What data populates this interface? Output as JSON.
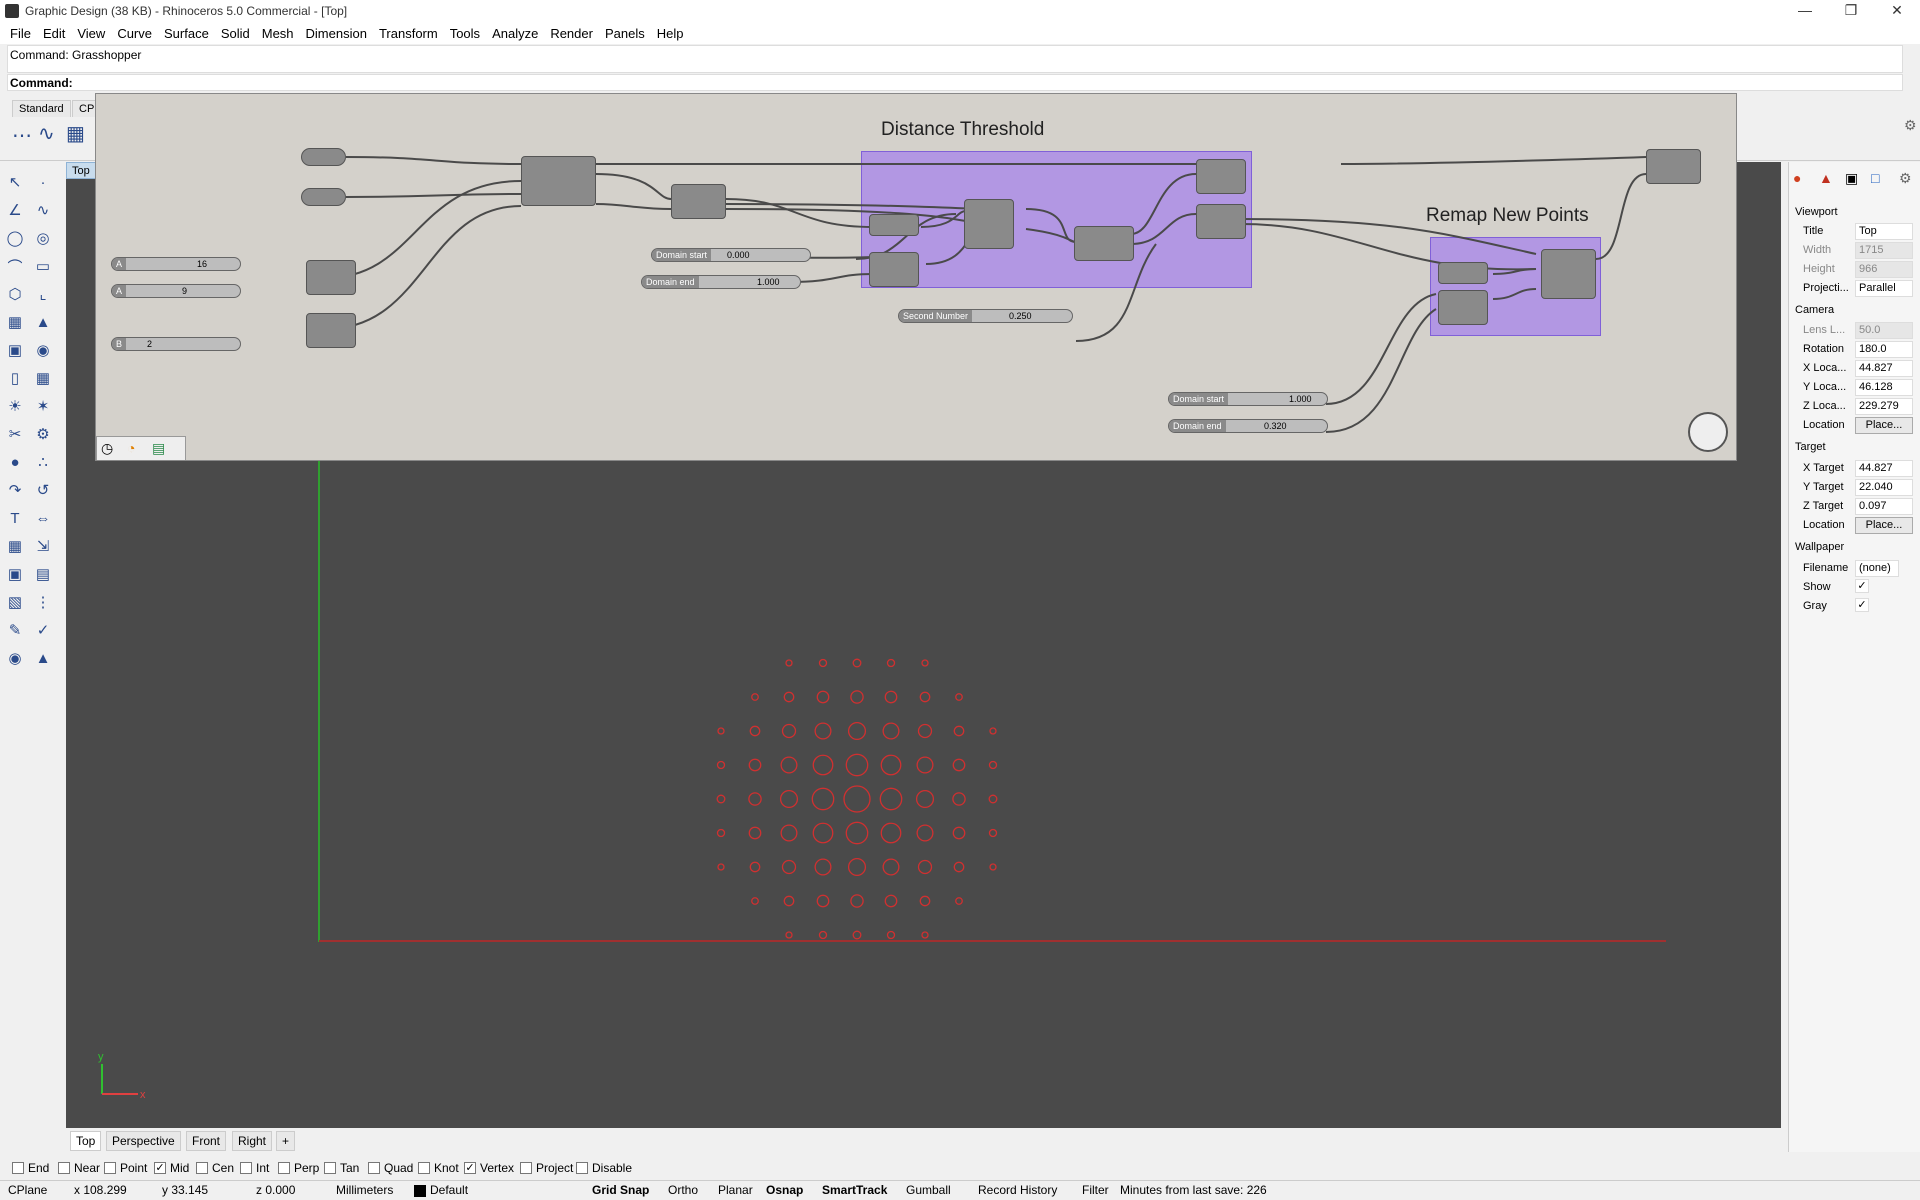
{
  "window": {
    "title": "Graphic Design (38 KB) - Rhinoceros 5.0 Commercial - [Top]"
  },
  "menu": [
    "File",
    "Edit",
    "View",
    "Curve",
    "Surface",
    "Solid",
    "Mesh",
    "Dimension",
    "Transform",
    "Tools",
    "Analyze",
    "Render",
    "Panels",
    "Help"
  ],
  "command": {
    "history": "Command: Grasshopper",
    "prompt": "Command:"
  },
  "toolbar_tabs": [
    "Standard",
    "CPl"
  ],
  "viewport": {
    "title": "Top"
  },
  "gh": {
    "groups": [
      "Distance Threshold",
      "Remap New Points"
    ],
    "sliders": [
      {
        "name": "A",
        "value": "16"
      },
      {
        "name": "A",
        "value": "9"
      },
      {
        "name": "B",
        "value": "2"
      },
      {
        "name": "Domain start",
        "value": "0.000"
      },
      {
        "name": "Domain end",
        "value": "1.000"
      },
      {
        "name": "Second Number",
        "value": "0.250"
      },
      {
        "name": "Domain start",
        "value": "1.000"
      },
      {
        "name": "Domain end",
        "value": "0.320"
      }
    ]
  },
  "view_tabs": [
    "Top",
    "Perspective",
    "Front",
    "Right"
  ],
  "osnaps": [
    {
      "label": "End",
      "checked": false
    },
    {
      "label": "Near",
      "checked": false
    },
    {
      "label": "Point",
      "checked": false
    },
    {
      "label": "Mid",
      "checked": true
    },
    {
      "label": "Cen",
      "checked": false
    },
    {
      "label": "Int",
      "checked": false
    },
    {
      "label": "Perp",
      "checked": false
    },
    {
      "label": "Tan",
      "checked": false
    },
    {
      "label": "Quad",
      "checked": false
    },
    {
      "label": "Knot",
      "checked": false
    },
    {
      "label": "Vertex",
      "checked": true
    },
    {
      "label": "Project",
      "checked": false
    },
    {
      "label": "Disable",
      "checked": false
    }
  ],
  "status": {
    "cplane": "CPlane",
    "x": "x 108.299",
    "y": "y 33.145",
    "z": "z 0.000",
    "units": "Millimeters",
    "layer": "Default",
    "toggles": [
      "Grid Snap",
      "Ortho",
      "Planar",
      "Osnap",
      "SmartTrack",
      "Gumball",
      "Record History",
      "Filter"
    ],
    "save_info": "Minutes from last save: 226"
  },
  "properties": {
    "viewport_header": "Viewport",
    "rows": [
      {
        "label": "Title",
        "value": "Top"
      },
      {
        "label": "Width",
        "value": "1715"
      },
      {
        "label": "Height",
        "value": "966"
      },
      {
        "label": "Projecti...",
        "value": "Parallel"
      }
    ],
    "camera_header": "Camera",
    "camera": [
      {
        "label": "Lens L...",
        "value": "50.0"
      },
      {
        "label": "Rotation",
        "value": "180.0"
      },
      {
        "label": "X Loca...",
        "value": "44.827"
      },
      {
        "label": "Y Loca...",
        "value": "46.128"
      },
      {
        "label": "Z Loca...",
        "value": "229.279"
      },
      {
        "label": "Location",
        "value": "Place..."
      }
    ],
    "target_header": "Target",
    "target": [
      {
        "label": "X Target",
        "value": "44.827"
      },
      {
        "label": "Y Target",
        "value": "22.040"
      },
      {
        "label": "Z Target",
        "value": "0.097"
      },
      {
        "label": "Location",
        "value": "Place..."
      }
    ],
    "wallpaper_header": "Wallpaper",
    "wallpaper": [
      {
        "label": "Filename",
        "value": "(none)"
      },
      {
        "label": "Show",
        "value": "✓"
      },
      {
        "label": "Gray",
        "value": "✓"
      }
    ]
  },
  "colors": {
    "accent": "#a078f0",
    "axis_x": "#c03030",
    "axis_y": "#30a030",
    "circle": "#d03030"
  }
}
